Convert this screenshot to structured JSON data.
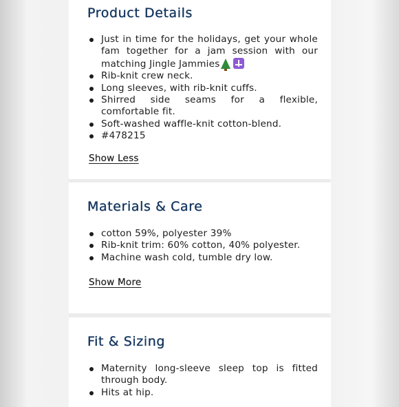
{
  "sections": [
    {
      "title": "Product Details",
      "items": [
        "Just in time for the holidays, get your whole fam together for a jam session with our matching Jingle Jammies",
        "Rib-knit crew neck.",
        "Long sleeves, with rib-knit cuffs.",
        "Shirred side seams for a flexible, comfortable fit.",
        "Soft-washed waffle-knit cotton-blend.",
        "#478215"
      ],
      "item0_icons": [
        "christmas-tree-icon",
        "menorah-icon"
      ],
      "toggle_label": "Show Less"
    },
    {
      "title": "Materials & Care",
      "items": [
        "cotton 59%, polyester 39%",
        "Rib-knit trim: 60% cotton, 40% polyester.",
        "Machine wash cold, tumble dry low."
      ],
      "toggle_label": "Show More"
    },
    {
      "title": "Fit & Sizing",
      "items": [
        "Maternity long-sleeve sleep top is fitted through body.",
        "Hits at hip."
      ]
    }
  ],
  "colors": {
    "heading": "#14365f",
    "text": "#1d1d1d",
    "card": "#ffffff",
    "gutter": "#ececec"
  }
}
